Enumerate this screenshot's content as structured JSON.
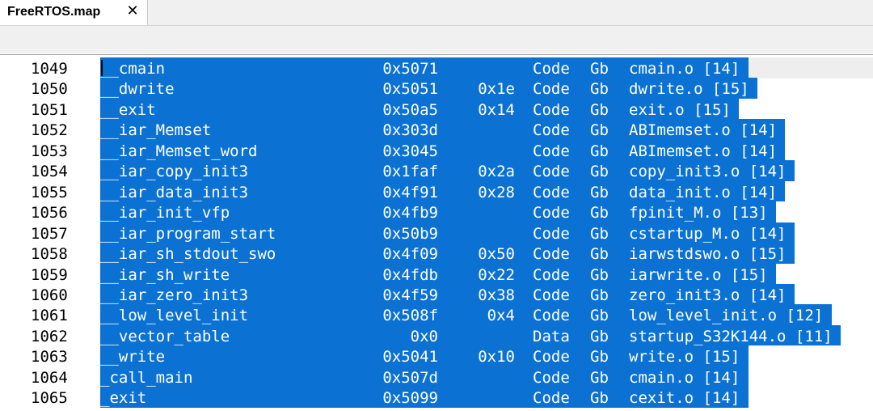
{
  "tab": {
    "title": "FreeRTOS.map",
    "close_icon": "close-icon"
  },
  "rows": [
    {
      "ln": "1049",
      "name": "__cmain",
      "addr": "0x5071",
      "size": "",
      "kind": "Code",
      "scope": "Gb",
      "obj": "cmain.o [14]"
    },
    {
      "ln": "1050",
      "name": "__dwrite",
      "addr": "0x5051",
      "size": "0x1e",
      "kind": "Code",
      "scope": "Gb",
      "obj": "dwrite.o [15]"
    },
    {
      "ln": "1051",
      "name": "__exit",
      "addr": "0x50a5",
      "size": "0x14",
      "kind": "Code",
      "scope": "Gb",
      "obj": "exit.o [15]"
    },
    {
      "ln": "1052",
      "name": "__iar_Memset",
      "addr": "0x303d",
      "size": "",
      "kind": "Code",
      "scope": "Gb",
      "obj": "ABImemset.o [14]"
    },
    {
      "ln": "1053",
      "name": "__iar_Memset_word",
      "addr": "0x3045",
      "size": "",
      "kind": "Code",
      "scope": "Gb",
      "obj": "ABImemset.o [14]"
    },
    {
      "ln": "1054",
      "name": "__iar_copy_init3",
      "addr": "0x1faf",
      "size": "0x2a",
      "kind": "Code",
      "scope": "Gb",
      "obj": "copy_init3.o [14]"
    },
    {
      "ln": "1055",
      "name": "__iar_data_init3",
      "addr": "0x4f91",
      "size": "0x28",
      "kind": "Code",
      "scope": "Gb",
      "obj": "data_init.o [14]"
    },
    {
      "ln": "1056",
      "name": "__iar_init_vfp",
      "addr": "0x4fb9",
      "size": "",
      "kind": "Code",
      "scope": "Gb",
      "obj": "fpinit_M.o [13]"
    },
    {
      "ln": "1057",
      "name": "__iar_program_start",
      "addr": "0x50b9",
      "size": "",
      "kind": "Code",
      "scope": "Gb",
      "obj": "cstartup_M.o [14]"
    },
    {
      "ln": "1058",
      "name": "__iar_sh_stdout_swo",
      "addr": "0x4f09",
      "size": "0x50",
      "kind": "Code",
      "scope": "Gb",
      "obj": "iarwstdswo.o [15]"
    },
    {
      "ln": "1059",
      "name": "__iar_sh_write",
      "addr": "0x4fdb",
      "size": "0x22",
      "kind": "Code",
      "scope": "Gb",
      "obj": "iarwrite.o [15]"
    },
    {
      "ln": "1060",
      "name": "__iar_zero_init3",
      "addr": "0x4f59",
      "size": "0x38",
      "kind": "Code",
      "scope": "Gb",
      "obj": "zero_init3.o [14]"
    },
    {
      "ln": "1061",
      "name": "__low_level_init",
      "addr": "0x508f",
      "size": "0x4",
      "kind": "Code",
      "scope": "Gb",
      "obj": "low_level_init.o [12]"
    },
    {
      "ln": "1062",
      "name": "__vector_table",
      "addr": "0x0",
      "size": "",
      "kind": "Data",
      "scope": "Gb",
      "obj": "startup_S32K144.o [11]"
    },
    {
      "ln": "1063",
      "name": "__write",
      "addr": "0x5041",
      "size": "0x10",
      "kind": "Code",
      "scope": "Gb",
      "obj": "write.o [15]"
    },
    {
      "ln": "1064",
      "name": "_call_main",
      "addr": "0x507d",
      "size": "",
      "kind": "Code",
      "scope": "Gb",
      "obj": "cmain.o [14]"
    },
    {
      "ln": "1065",
      "name": "_exit",
      "addr": "0x5099",
      "size": "",
      "kind": "Code",
      "scope": "Gb",
      "obj": "cexit.o [14]"
    }
  ],
  "colors": {
    "selection": "#0b72d4",
    "selected_text": "#ffffff",
    "line_number": "#000000"
  }
}
